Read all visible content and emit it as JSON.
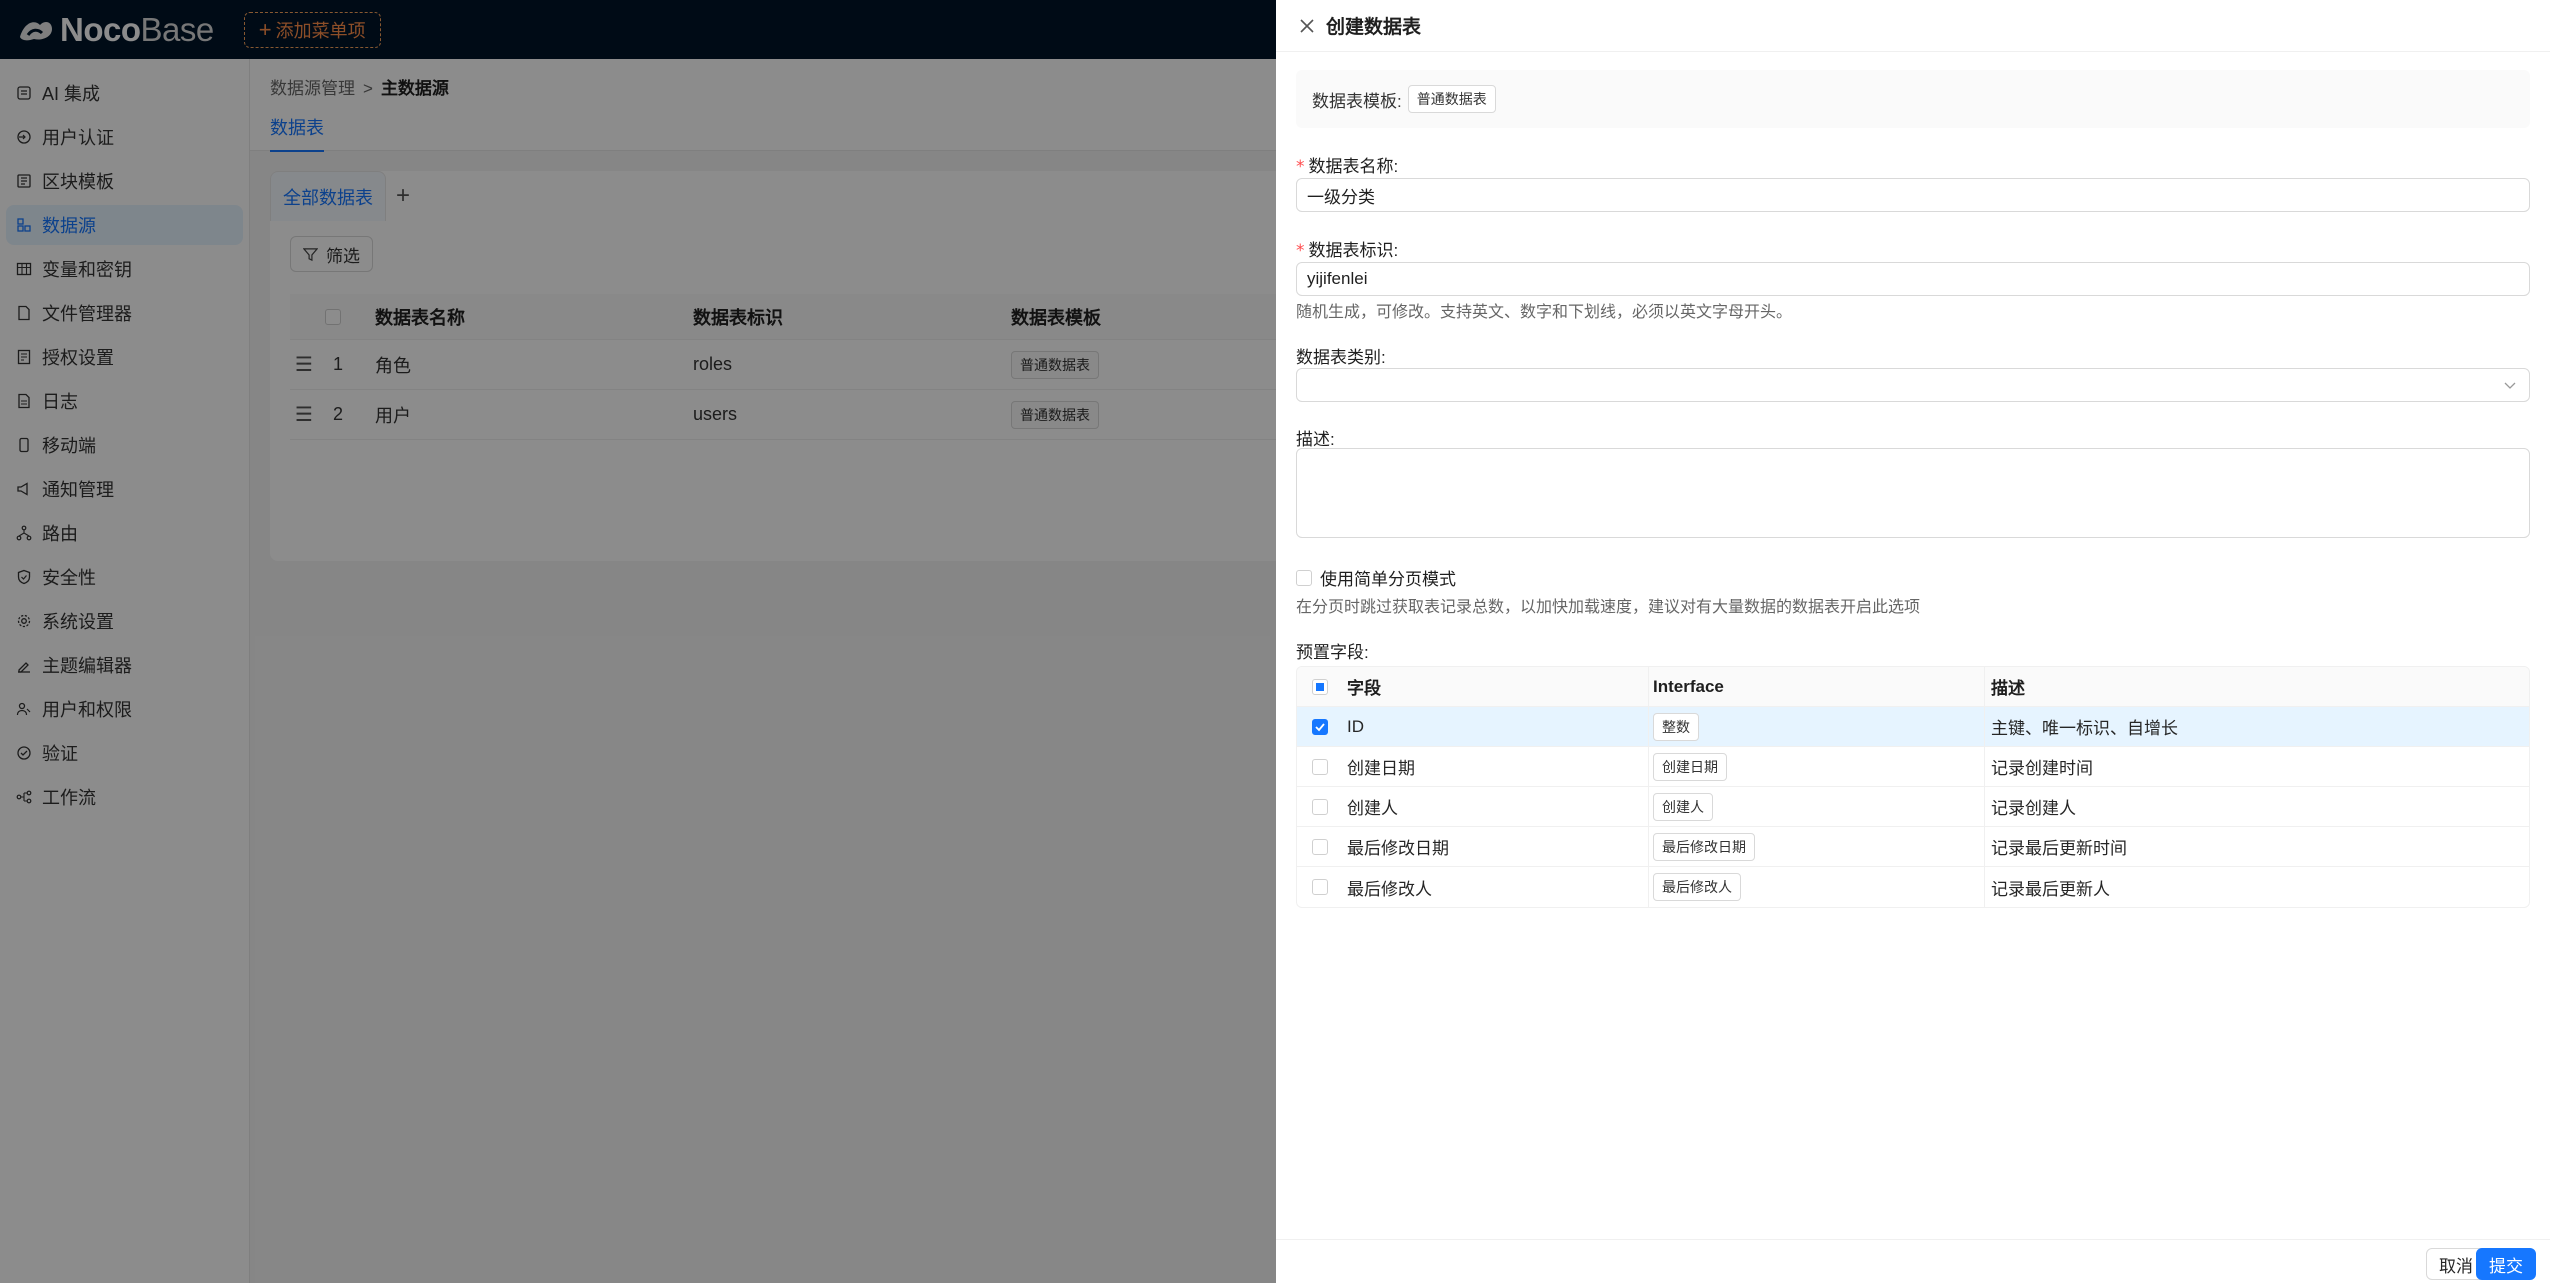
{
  "app": {
    "logo_noco": "Noco",
    "logo_base": "Base",
    "add_menu": "添加菜单项"
  },
  "sidebar": {
    "items": [
      {
        "label": "AI 集成",
        "icon": "ai-icon"
      },
      {
        "label": "用户认证",
        "icon": "login-icon"
      },
      {
        "label": "区块模板",
        "icon": "template-icon"
      },
      {
        "label": "数据源",
        "icon": "database-icon",
        "active": true
      },
      {
        "label": "变量和密钥",
        "icon": "table-icon"
      },
      {
        "label": "文件管理器",
        "icon": "file-icon"
      },
      {
        "label": "授权设置",
        "icon": "license-icon"
      },
      {
        "label": "日志",
        "icon": "log-icon"
      },
      {
        "label": "移动端",
        "icon": "mobile-icon"
      },
      {
        "label": "通知管理",
        "icon": "notification-icon"
      },
      {
        "label": "路由",
        "icon": "route-icon"
      },
      {
        "label": "安全性",
        "icon": "shield-icon"
      },
      {
        "label": "系统设置",
        "icon": "gear-icon"
      },
      {
        "label": "主题编辑器",
        "icon": "theme-icon"
      },
      {
        "label": "用户和权限",
        "icon": "users-icon"
      },
      {
        "label": "验证",
        "icon": "check-circle-icon"
      },
      {
        "label": "工作流",
        "icon": "workflow-icon"
      }
    ]
  },
  "content": {
    "breadcrumb": [
      "数据源管理",
      "主数据源"
    ],
    "tab": "数据表",
    "card_tab": "全部数据表",
    "filter_label": "筛选",
    "table_headers": [
      "数据表名称",
      "数据表标识",
      "数据表模板"
    ],
    "rows": [
      {
        "index": "1",
        "name": "角色",
        "key": "roles",
        "template": "普通数据表"
      },
      {
        "index": "2",
        "name": "用户",
        "key": "users",
        "template": "普通数据表"
      }
    ]
  },
  "drawer": {
    "title": "创建数据表",
    "template_label": "数据表模板:",
    "template_value": "普通数据表",
    "name_label": "数据表名称:",
    "name_value": "一级分类",
    "key_label": "数据表标识:",
    "key_value": "yijifenlei",
    "key_help": "随机生成，可修改。支持英文、数字和下划线，必须以英文字母开头。",
    "category_label": "数据表类别:",
    "category_value": "",
    "description_label": "描述:",
    "simple_paging_label": "使用简单分页模式",
    "simple_paging_checked": false,
    "simple_paging_help": "在分页时跳过获取表记录总数，以加快加载速度，建议对有大量数据的数据表开启此选项",
    "preset_fields_label": "预置字段:",
    "preset_headers": [
      "字段",
      "Interface",
      "描述"
    ],
    "preset_fields": [
      {
        "name": "ID",
        "interface": "整数",
        "description": "主键、唯一标识、自增长",
        "checked": true
      },
      {
        "name": "创建日期",
        "interface": "创建日期",
        "description": "记录创建时间",
        "checked": false
      },
      {
        "name": "创建人",
        "interface": "创建人",
        "description": "记录创建人",
        "checked": false
      },
      {
        "name": "最后修改日期",
        "interface": "最后修改日期",
        "description": "记录最后更新时间",
        "checked": false
      },
      {
        "name": "最后修改人",
        "interface": "最后修改人",
        "description": "记录最后更新人",
        "checked": false
      }
    ],
    "cancel_label": "取消",
    "submit_label": "提交"
  },
  "colors": {
    "primary": "#1677ff",
    "topbar": "#001529",
    "required": "#ff4d4f",
    "add_menu": "#ff8f4a"
  }
}
